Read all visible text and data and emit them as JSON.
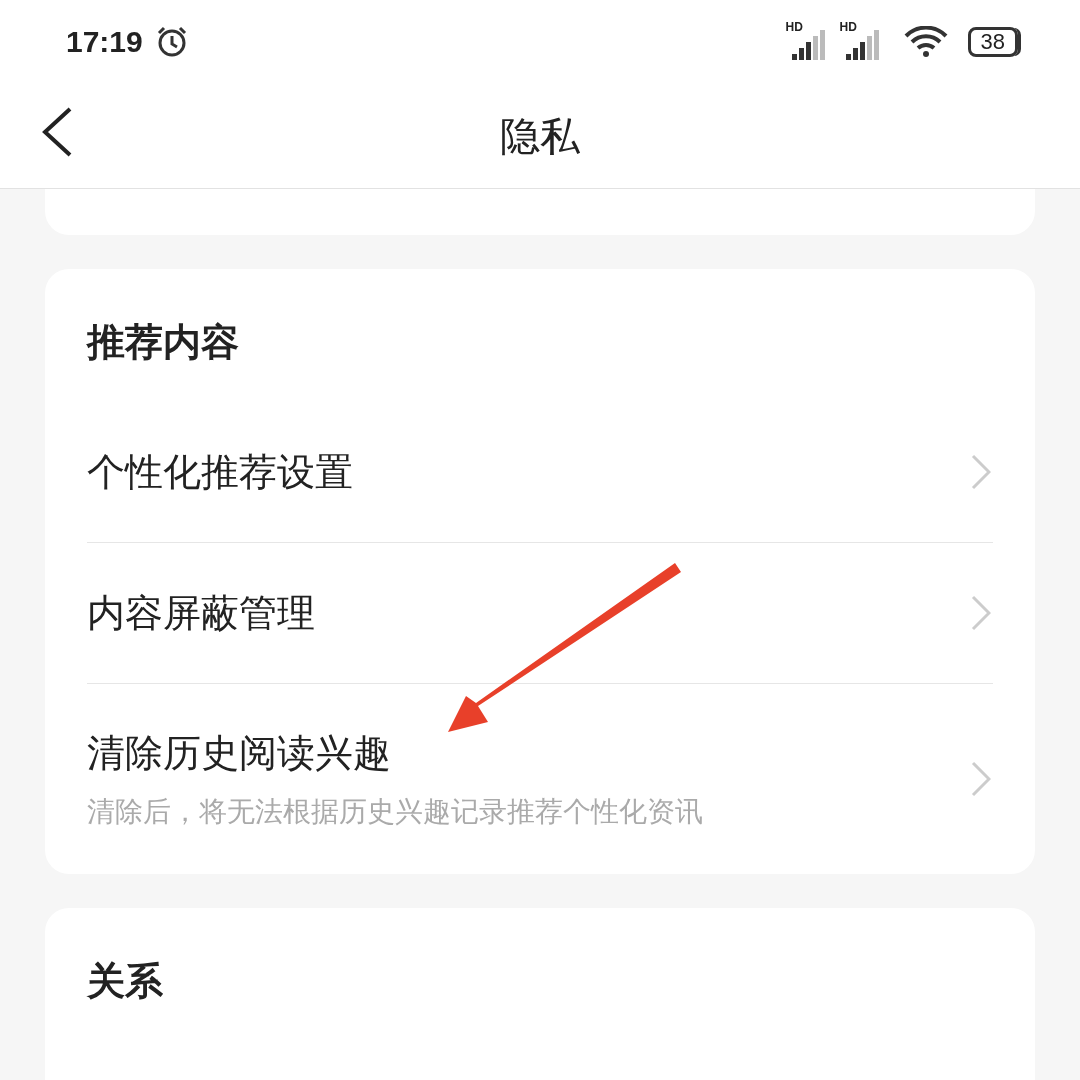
{
  "status_bar": {
    "time": "17:19",
    "signals": [
      {
        "label": "HD"
      },
      {
        "label": "HD"
      }
    ],
    "battery": "38"
  },
  "header": {
    "title": "隐私"
  },
  "sections": [
    {
      "title": "推荐内容",
      "items": [
        {
          "label": "个性化推荐设置"
        },
        {
          "label": "内容屏蔽管理"
        },
        {
          "label": "清除历史阅读兴趣",
          "subtitle": "清除后，将无法根据历史兴趣记录推荐个性化资讯"
        }
      ]
    },
    {
      "title": "关系"
    }
  ]
}
